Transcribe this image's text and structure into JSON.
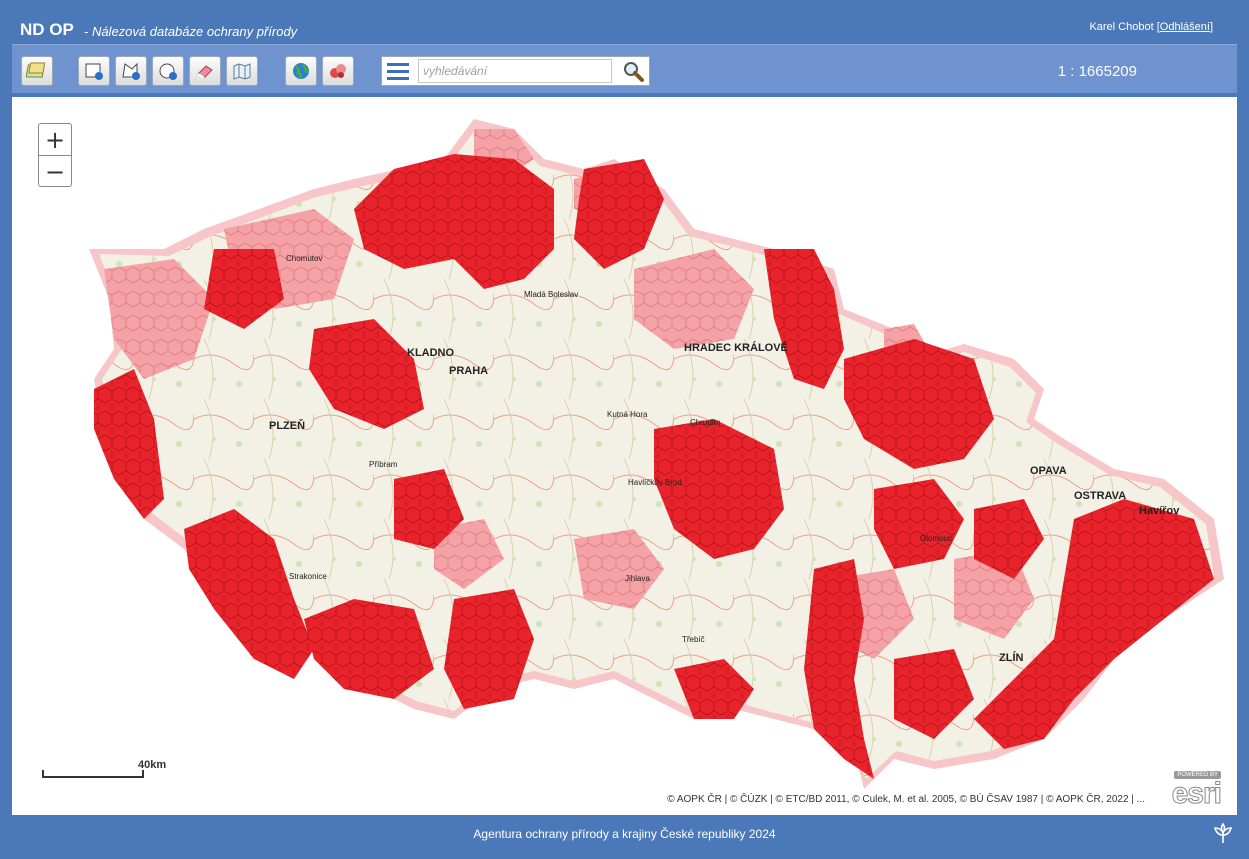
{
  "header": {
    "app_name": "ND OP",
    "app_subtitle": "- Nálezová databáze ochrany přírody",
    "user_name": "Karel Chobot",
    "logout_label": "Odhlášení"
  },
  "toolbar": {
    "buttons": [
      {
        "name": "layers-icon"
      },
      {
        "name": "identify-rectangle-icon"
      },
      {
        "name": "identify-polygon-icon"
      },
      {
        "name": "identify-circle-icon"
      },
      {
        "name": "eraser-icon"
      },
      {
        "name": "map-info-icon"
      },
      {
        "name": "globe-icon"
      },
      {
        "name": "filter-icon"
      }
    ],
    "search_placeholder": "vyhledávání",
    "scale_text": "1 : 1665209"
  },
  "map": {
    "zoom_in_label": "+",
    "zoom_out_label": "−",
    "scalebar_label": "40km",
    "attribution": "© AOPK ČR | © ČÚZK | © ETC/BD 2011, © Culek, M. et al. 2005, © BÚ ČSAV 1987 | © AOPK ČR, 2022 | ...",
    "esri_powered": "POWERED BY",
    "esri_name": "esri",
    "colors": {
      "hex_dark": "#e8232b",
      "hex_light": "#f4a2a6",
      "border_glow": "#f7c6c8",
      "land": "#f3f0e6"
    },
    "cities": [
      {
        "label": "Chomutov"
      },
      {
        "label": "PLZEŇ"
      },
      {
        "label": "PRAHA"
      },
      {
        "label": "HRADEC KRÁLOVÉ"
      },
      {
        "label": "Kutná Hora"
      },
      {
        "label": "Chrudim"
      },
      {
        "label": "Havlíčkův Brod"
      },
      {
        "label": "Příbram"
      },
      {
        "label": "Strakonice"
      },
      {
        "label": "OPAVA"
      },
      {
        "label": "OSTRAVA"
      },
      {
        "label": "Olomouc"
      },
      {
        "label": "ZLÍN"
      },
      {
        "label": "Třebíč"
      },
      {
        "label": "KLADNO"
      },
      {
        "label": "Mladá Boleslav"
      },
      {
        "label": "Jihlava"
      },
      {
        "label": "Havířov"
      }
    ]
  },
  "footer": {
    "text": "Agentura ochrany přírody a krajiny České republiky 2024"
  }
}
